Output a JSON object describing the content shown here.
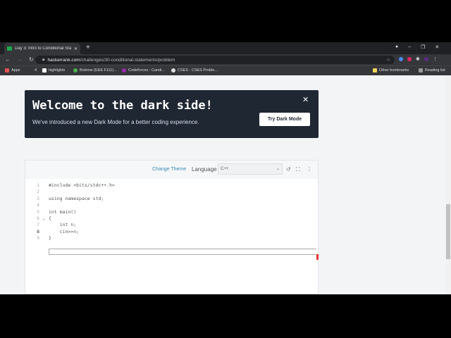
{
  "browser": {
    "tab_title": "Day 3: Intro to Conditional Statements",
    "url_domain": "hackerrank.com",
    "url_path": "/challenges/30-conditional-statements/problem",
    "bookmarks": [
      "Apps",
      "4",
      "highlights",
      "Bobrow (EEE F111)...",
      "Codeforces - Candi...",
      "CSES - CSES Proble..."
    ],
    "other_bookmarks": "Other bookmarks",
    "reading_list": "Reading list"
  },
  "banner": {
    "title": "Welcome to the dark side!",
    "subtitle": "We've introduced a new Dark Mode for a better coding experience.",
    "button": "Try Dark Mode"
  },
  "editor": {
    "change_theme": "Change Theme",
    "language_label": "Language",
    "language_value": "C++",
    "lines": [
      "#include <bits/stdc++.h>",
      "",
      "using namespace std;",
      "",
      "int main()",
      "{",
      "    int n;",
      "    cin>>n;",
      "}"
    ]
  }
}
